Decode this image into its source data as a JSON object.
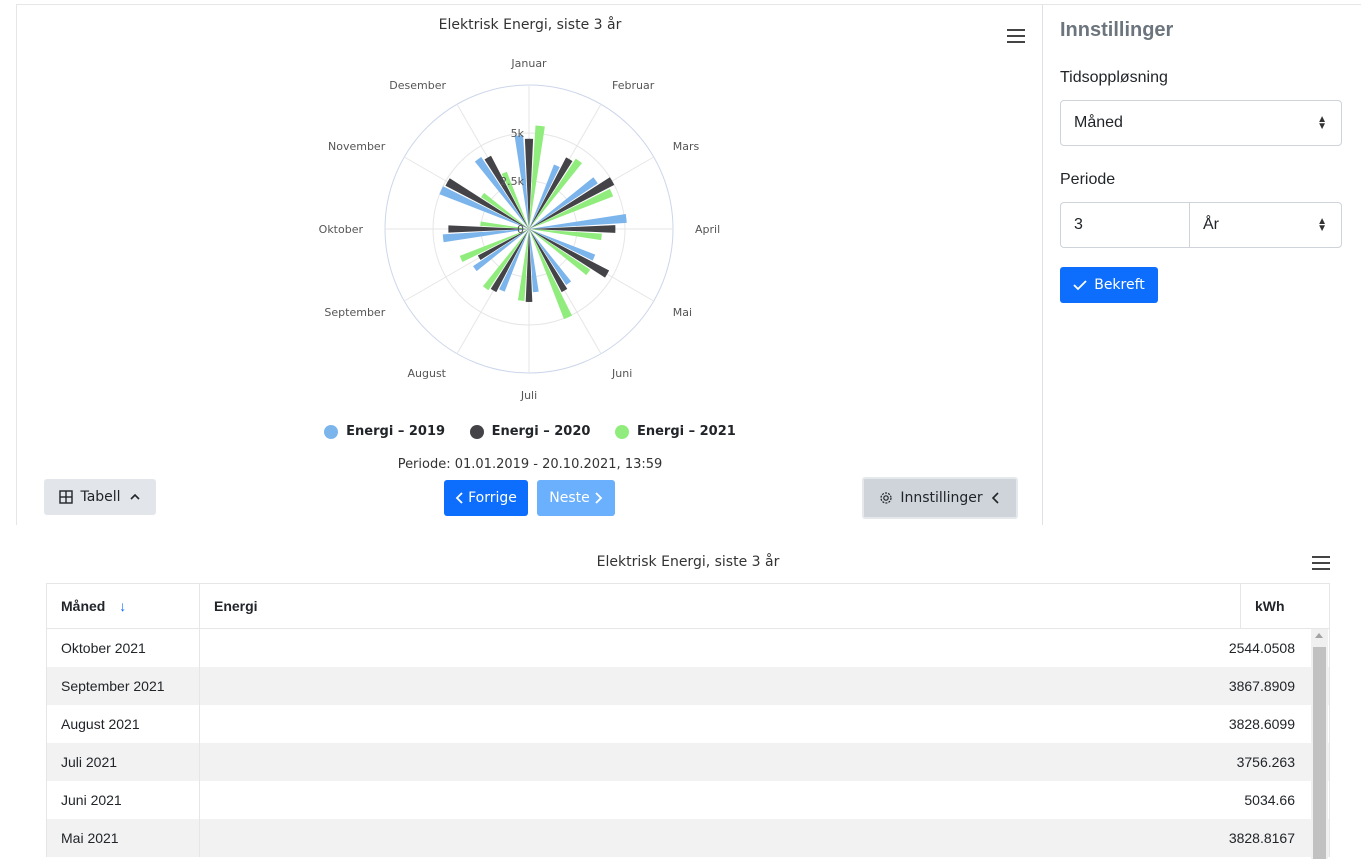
{
  "chart": {
    "title": "Elektrisk Energi, siste 3 år",
    "period_text": "Periode: 01.01.2019 - 20.10.2021, 13:59",
    "prev_label": "Forrige",
    "next_label": "Neste",
    "table_toggle_label": "Tabell",
    "settings_toggle_label": "Innstillinger"
  },
  "chart_data": {
    "type": "bar",
    "polar": true,
    "title": "Elektrisk Energi, siste 3 år",
    "categories": [
      "Januar",
      "Februar",
      "Mars",
      "April",
      "Mai",
      "Juni",
      "Juli",
      "August",
      "September",
      "Oktober",
      "November",
      "Desember"
    ],
    "rtick_labels": [
      "0",
      "2.5k",
      "5k"
    ],
    "rlim": [
      0,
      7500
    ],
    "series": [
      {
        "name": "Energi – 2019",
        "color": "#7cb5ec",
        "values": [
          4900,
          3600,
          4300,
          5100,
          3700,
          3500,
          3300,
          3500,
          3500,
          4500,
          5000,
          4500
        ]
      },
      {
        "name": "Energi – 2020",
        "color": "#434348",
        "values": [
          4700,
          4200,
          5000,
          4500,
          4700,
          3700,
          3800,
          3700,
          3000,
          4200,
          4900,
          4300
        ]
      },
      {
        "name": "Energi – 2021",
        "color": "#90ed7d",
        "values": [
          5400,
          4400,
          4700,
          3800,
          3829,
          5035,
          3756,
          3829,
          3868,
          2544,
          3000,
          3200
        ]
      }
    ],
    "legend_position": "bottom",
    "grid": true
  },
  "settings": {
    "title": "Innstillinger",
    "resolution_label": "Tidsoppløsning",
    "resolution_value": "Måned",
    "period_label": "Periode",
    "period_number": "3",
    "period_unit": "År",
    "confirm_label": "Bekreft"
  },
  "table": {
    "title": "Elektrisk Energi, siste 3 år",
    "headers": [
      "Måned",
      "Energi",
      "kWh"
    ],
    "rows": [
      [
        "Oktober 2021",
        "2544.0508"
      ],
      [
        "September 2021",
        "3867.8909"
      ],
      [
        "August 2021",
        "3828.6099"
      ],
      [
        "Juli 2021",
        "3756.263"
      ],
      [
        "Juni 2021",
        "5034.66"
      ],
      [
        "Mai 2021",
        "3828.8167"
      ]
    ]
  },
  "colors": {
    "primary": "#0d6efd",
    "primary_disabled": "#6ab0fd",
    "series_2019": "#7cb5ec",
    "series_2020": "#434348",
    "series_2021": "#90ed7d"
  },
  "icons": {
    "menu": "hamburger-icon",
    "table": "table-grid-icon",
    "chevron_up": "chevron-up-icon",
    "chevron_left": "chevron-left-icon",
    "chevron_right": "chevron-right-icon",
    "gear": "gear-icon",
    "check": "check-icon",
    "sort_down": "sort-down-arrow-icon",
    "select_updown": "select-updown-icon"
  }
}
